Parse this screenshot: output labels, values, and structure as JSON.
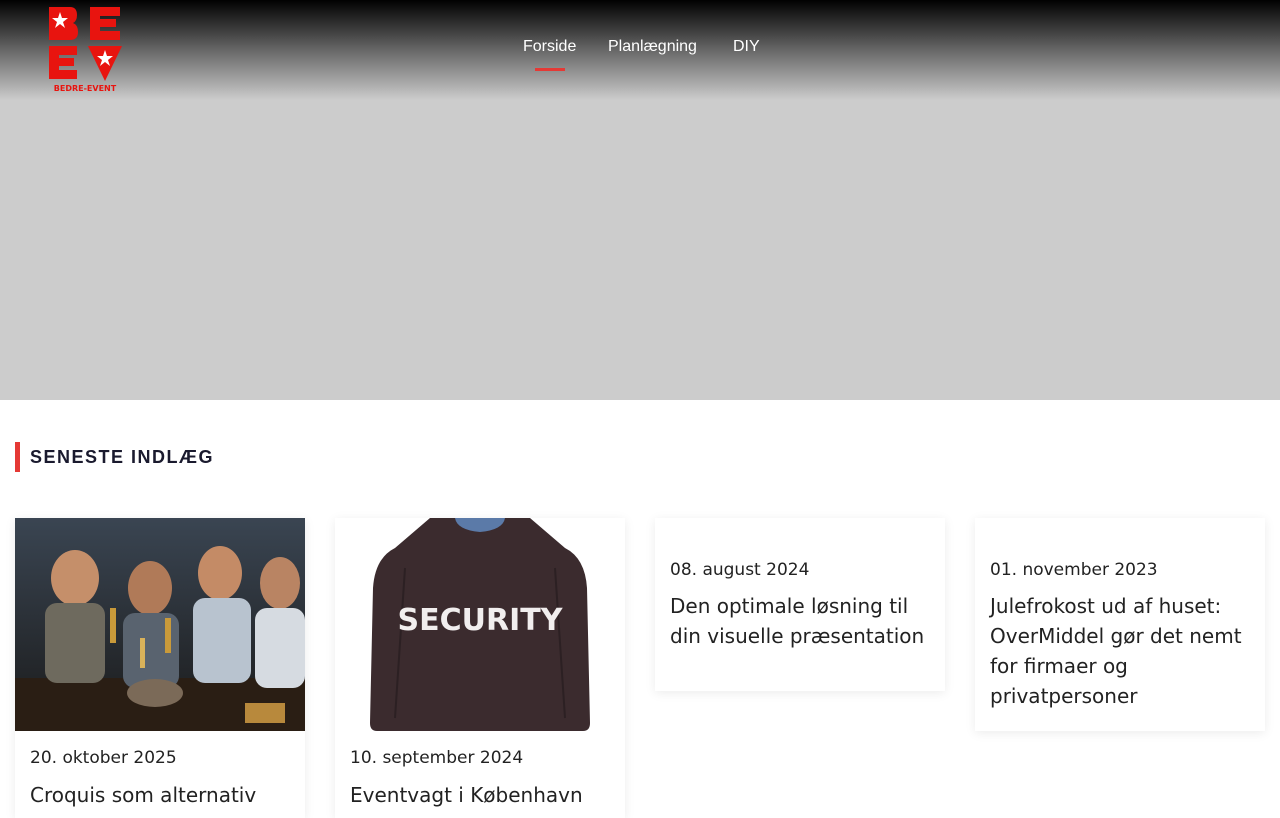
{
  "brand": {
    "logo_text": "BEDRE-EVENT",
    "accent_color": "#e53935"
  },
  "nav": {
    "items": [
      {
        "label": "Forside",
        "active": true
      },
      {
        "label": "Planlægning",
        "active": false
      },
      {
        "label": "DIY",
        "active": false
      }
    ]
  },
  "section": {
    "heading": "SENESTE INDLÆG"
  },
  "posts": [
    {
      "date": "20. oktober 2025",
      "title": "Croquis som alternativ",
      "has_image": true,
      "image": "party-toast-photo"
    },
    {
      "date": "10. september 2024",
      "title": "Eventvagt i København",
      "has_image": true,
      "image": "security-jacket-photo"
    },
    {
      "date": "08. august 2024",
      "title": "Den optimale løsning til din visuelle præsentation",
      "has_image": false
    },
    {
      "date": "01. november 2023",
      "title": "Julefrokost ud af huset: OverMiddel gør det nemt for firmaer og privatpersoner",
      "has_image": false
    }
  ]
}
